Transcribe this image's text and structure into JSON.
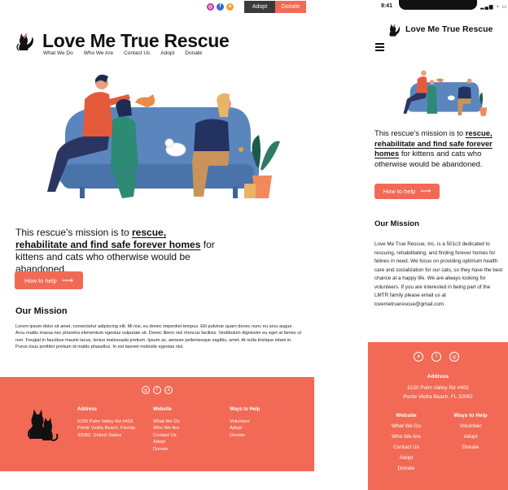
{
  "colors": {
    "accent": "#f26a55",
    "dark": "#3a3a3a",
    "sofa": "#5b86bd"
  },
  "desktop": {
    "topbar": {
      "social_icons": [
        "instagram-icon",
        "facebook-icon",
        "amazon-icon"
      ],
      "adopt": "Adopt",
      "donate": "Donate"
    },
    "brand": {
      "title": "Love Me True Rescue"
    },
    "nav": [
      "What We Do",
      "Who We Are",
      "Contact Us",
      "Adopt",
      "Donate"
    ],
    "mission": {
      "prefix": "This rescue's mission is to ",
      "highlight": "rescue, rehabilitate and find safe forever homes",
      "suffix": " for kittens and cats who otherwise would be abandoned."
    },
    "help_button": "How to help",
    "mission_heading": "Our  Mission",
    "lorem": "Lorem ipsum dolor sit amet, consectetur adipiscing elit. Mi nisi, eu donec imperdiet tempus. Elit pulvinar quam donec nunc eu arcu augue. Arcu mattis massa nec pharetra elementum egestas vulputate sit. Donec libero nisl rhoncus facilisis. Vestibulum dignissim eu eget at fames ut non. Feugiat in faucibus mauris lacus, lectus malesuada pretium. Ipsum ac, aenean pellentesque sagittis, amet. At nulla tristique etiam in. Purus risus porttitor pretium id mattis phasellus. In est laoreet molestie egestas nisl.",
    "footer": {
      "address_heading": "Address",
      "address_lines": [
        "5150 Palm Valley Rd #403",
        "Ponte Vedra Beach, Florida",
        "32082, United States"
      ],
      "website_heading": "Website",
      "website_links": [
        "What We Do",
        "Who We Are",
        "Contact Us",
        "Adopt",
        "Donate"
      ],
      "help_heading": "Ways to Help",
      "help_links": [
        "Volunteer",
        "Adopt",
        "Donate"
      ]
    }
  },
  "mobile": {
    "status_time": "9:41",
    "brand": {
      "title": "Love Me True Rescue"
    },
    "mission": {
      "prefix": "This rescue's mission is to ",
      "highlight": "rescue, rehabilitate and find safe forever homes",
      "suffix": " for kittens and cats who otherwise would be abandoned."
    },
    "help_button": "How to help",
    "mission_heading": "Our Mission",
    "body": "Love Me True Rescue, Inc. is a 501c3 dedicated to rescuing, rehabilitating, and finding forever homes for felines in need. We focus on providing optimum health care and socialization for our cats, so they have the best chance at a happy life. We are always looking for volunteers. If you are interested in being part of the LMTR family please email us at lovemetruerescue@gmail.com.",
    "footer": {
      "address_heading": "Address",
      "address_lines": [
        "5150 Palm Valley Rd #403",
        "Ponte Vedra Beach, FL 32082"
      ],
      "website_heading": "Website",
      "website_links": [
        "What We Do",
        "Who We Are",
        "Contact Us",
        "Adopt",
        "Donate"
      ],
      "help_heading": "Ways to Help",
      "help_links": [
        "Volunteer",
        "Adopt",
        "Donate"
      ]
    }
  }
}
